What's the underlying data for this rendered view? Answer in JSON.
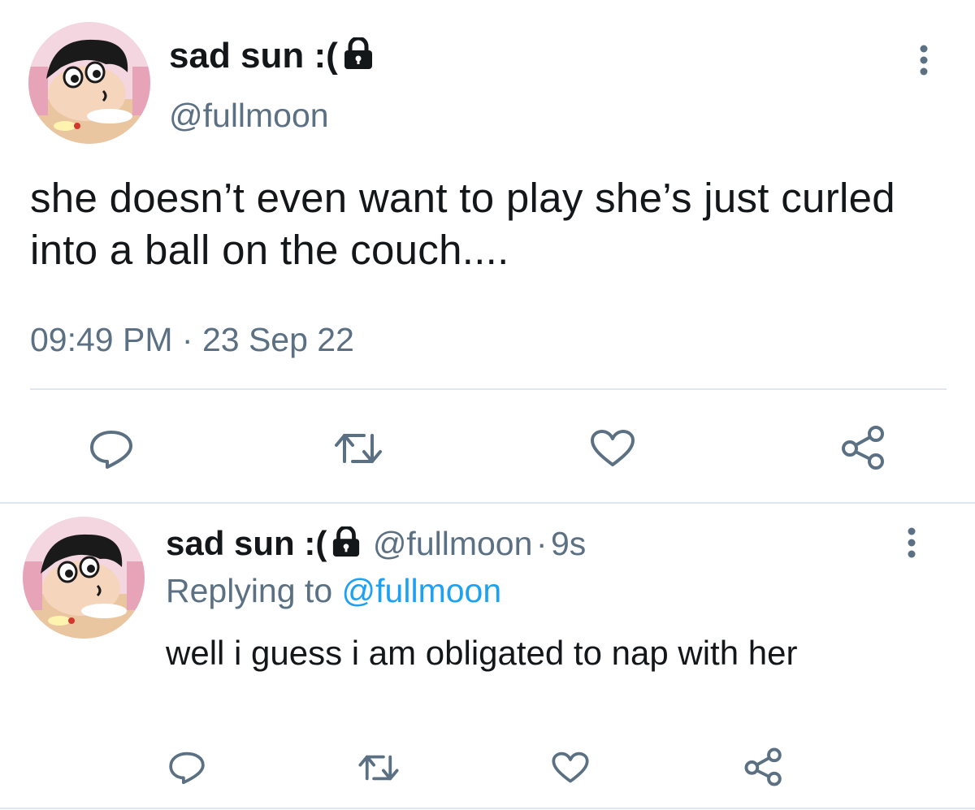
{
  "main_tweet": {
    "display_name": "sad sun :(",
    "handle": "@fullmoon",
    "text": "she doesn’t even want to play she’s just curled into a ball on the couch....",
    "time": "09:49 PM",
    "separator": "·",
    "date": "23 Sep 22",
    "icons": [
      "lock-icon",
      "more-icon",
      "reply-icon",
      "retweet-icon",
      "like-icon",
      "share-icon"
    ]
  },
  "reply_tweet": {
    "display_name": "sad sun :(",
    "handle": "@fullmoon",
    "separator": "·",
    "age": "9s",
    "replying_label": "Replying to",
    "replying_handle": "@fullmoon",
    "text": "well i guess i am obligated to nap with her"
  },
  "colors": {
    "text": "#14171a",
    "secondary": "#5b7083",
    "link": "#1da1f2",
    "divider": "#e1e8ed"
  }
}
